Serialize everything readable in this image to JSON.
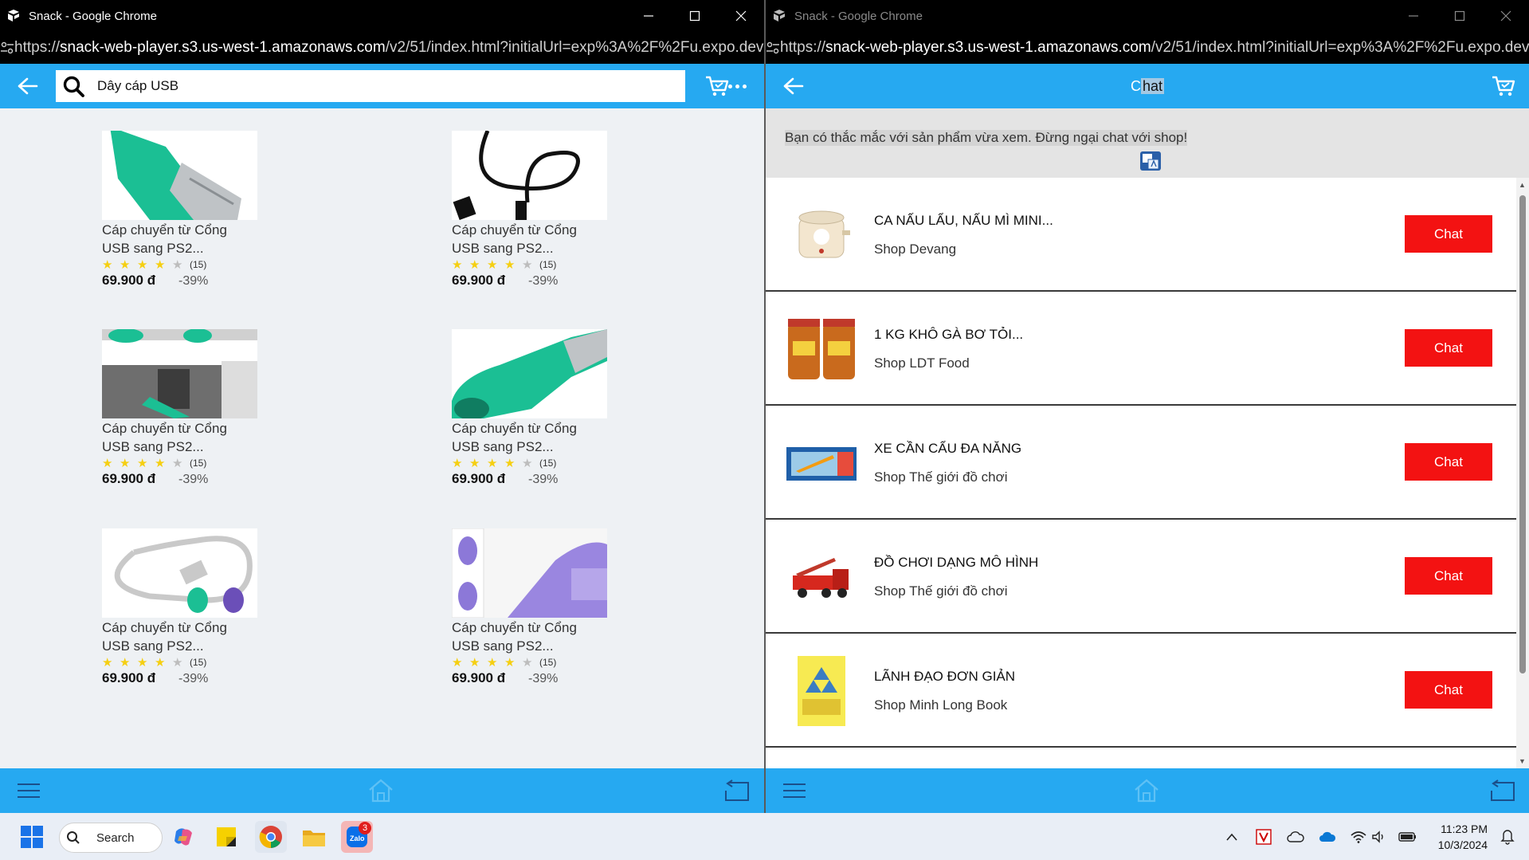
{
  "left_window": {
    "title": "Snack - Google Chrome",
    "url_prefix": "https://",
    "url_host": "snack-web-player.s3.us-west-1.amazonaws.com",
    "url_rest": "/v2/51/index.html?initialUrl=exp%3A%2F%2Fu.expo.dev%...",
    "search_value": "Dây cáp USB",
    "products": [
      {
        "name_line1": "Cáp chuyển từ Cổng",
        "name_line2": "USB sang PS2...",
        "rating": 4,
        "count": "(15)",
        "price": "69.900 đ",
        "discount": "-39%"
      },
      {
        "name_line1": "Cáp chuyển từ Cổng",
        "name_line2": "USB sang PS2...",
        "rating": 4,
        "count": "(15)",
        "price": "69.900 đ",
        "discount": "-39%"
      },
      {
        "name_line1": "Cáp chuyển từ Cổng",
        "name_line2": "USB sang PS2...",
        "rating": 4,
        "count": "(15)",
        "price": "69.900 đ",
        "discount": "-39%"
      },
      {
        "name_line1": "Cáp chuyển từ Cổng",
        "name_line2": "USB sang PS2...",
        "rating": 4,
        "count": "(15)",
        "price": "69.900 đ",
        "discount": "-39%"
      },
      {
        "name_line1": "Cáp chuyển từ Cổng",
        "name_line2": "USB sang PS2...",
        "rating": 4,
        "count": "(15)",
        "price": "69.900 đ",
        "discount": "-39%"
      },
      {
        "name_line1": "Cáp chuyển từ Cổng",
        "name_line2": "USB sang PS2...",
        "rating": 4,
        "count": "(15)",
        "price": "69.900 đ",
        "discount": "-39%"
      }
    ]
  },
  "right_window": {
    "title": "Snack - Google Chrome",
    "url_prefix": "https://",
    "url_host": "snack-web-player.s3.us-west-1.amazonaws.com",
    "url_rest": "/v2/51/index.html?initialUrl=exp%3A%2F%2Fu.expo.dev%...",
    "header_title_plain": "C",
    "header_title_selected": "hat",
    "banner": "Bạn có thắc mắc với sản phẩm vừa xem. Đừng ngại chat với shop!",
    "chats": [
      {
        "product": "CA NẤU LẨU, NẤU MÌ MINI...",
        "shop": "Shop Devang",
        "button": "Chat"
      },
      {
        "product": "1 KG KHÔ GÀ BƠ TỎI...",
        "shop": "Shop LDT Food",
        "button": "Chat"
      },
      {
        "product": "XE CẦN CẨU ĐA NĂNG",
        "shop": "Shop Thế giới đồ chơi",
        "button": "Chat"
      },
      {
        "product": "ĐỒ CHƠI DẠNG MÔ HÌNH",
        "shop": "Shop Thế giới đồ chơi",
        "button": "Chat"
      },
      {
        "product": "LÃNH ĐẠO ĐƠN GIẢN",
        "shop": "Shop Minh Long Book",
        "button": "Chat"
      }
    ]
  },
  "taskbar": {
    "search_label": "Search",
    "zalo_badge": "3",
    "time": "11:23 PM",
    "date": "10/3/2024"
  },
  "colors": {
    "appbar": "#26a9f1",
    "chat_button": "#f31212",
    "star": "#f5cf12"
  }
}
